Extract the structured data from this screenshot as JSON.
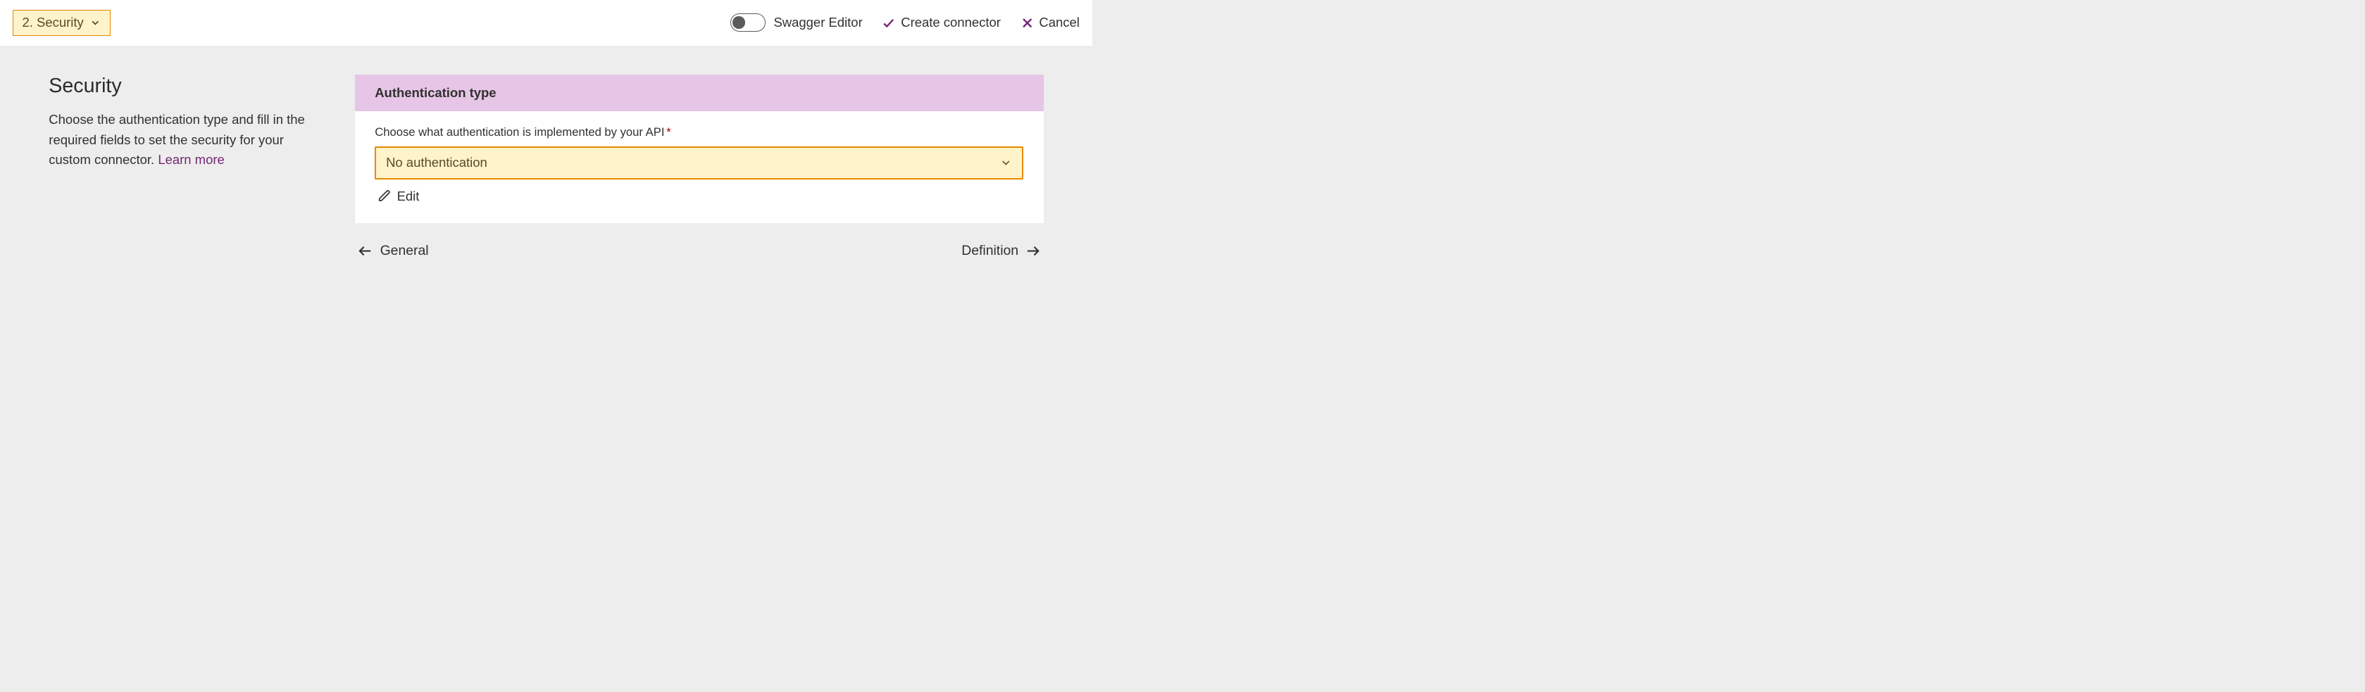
{
  "top_bar": {
    "step_label": "2. Security",
    "swagger_toggle_label": "Swagger Editor",
    "create_label": "Create connector",
    "cancel_label": "Cancel"
  },
  "left": {
    "title": "Security",
    "description": "Choose the authentication type and fill in the required fields to set the security for your custom connector. ",
    "learn_more": "Learn more"
  },
  "panel": {
    "header": "Authentication type",
    "field_label": "Choose what authentication is implemented by your API",
    "selected_value": "No authentication",
    "edit_label": "Edit"
  },
  "nav": {
    "prev_label": "General",
    "next_label": "Definition"
  }
}
